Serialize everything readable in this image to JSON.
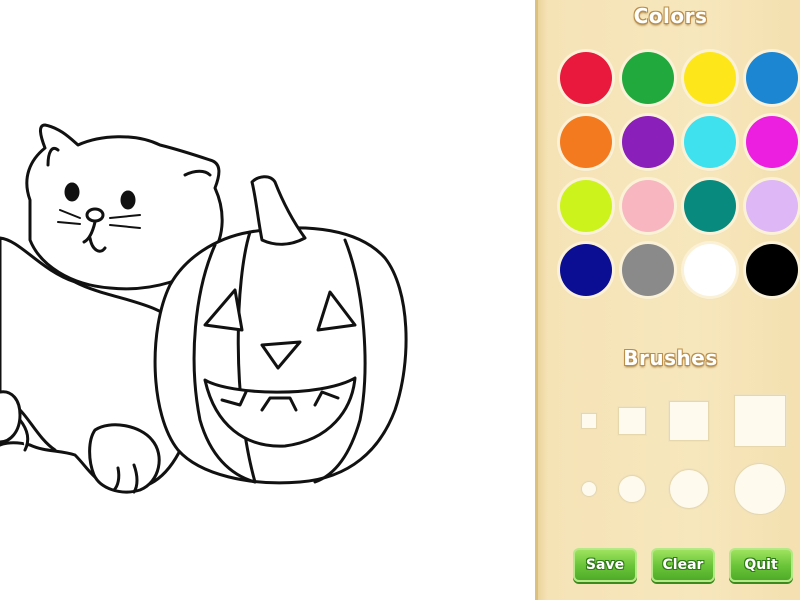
{
  "panel": {
    "colors_title": "Colors",
    "brushes_title": "Brushes",
    "colors": [
      {
        "name": "red",
        "hex": "#e8193c"
      },
      {
        "name": "green",
        "hex": "#21a93d"
      },
      {
        "name": "yellow",
        "hex": "#fde619"
      },
      {
        "name": "blue",
        "hex": "#1c86d3"
      },
      {
        "name": "orange",
        "hex": "#f47a1f"
      },
      {
        "name": "purple",
        "hex": "#8a1fb9"
      },
      {
        "name": "cyan",
        "hex": "#3fe1ee"
      },
      {
        "name": "magenta",
        "hex": "#ec1fe0"
      },
      {
        "name": "lime",
        "hex": "#ccf31c"
      },
      {
        "name": "pink",
        "hex": "#f8b6c1"
      },
      {
        "name": "teal",
        "hex": "#098a7e"
      },
      {
        "name": "lavender",
        "hex": "#ddb7f6"
      },
      {
        "name": "navy",
        "hex": "#0b0d92"
      },
      {
        "name": "gray",
        "hex": "#8a8a8a"
      },
      {
        "name": "white",
        "hex": "#ffffff"
      },
      {
        "name": "black",
        "hex": "#000000"
      }
    ],
    "brushes": [
      {
        "shape": "square",
        "size": "small"
      },
      {
        "shape": "square",
        "size": "medium"
      },
      {
        "shape": "square",
        "size": "large"
      },
      {
        "shape": "square",
        "size": "extra-large"
      },
      {
        "shape": "circle",
        "size": "small"
      },
      {
        "shape": "circle",
        "size": "medium"
      },
      {
        "shape": "circle",
        "size": "large"
      },
      {
        "shape": "circle",
        "size": "extra-large"
      }
    ],
    "buttons": {
      "save_label": "Save",
      "clear_label": "Clear",
      "quit_label": "Quit"
    }
  },
  "canvas": {
    "drawing": "kitten-and-jack-o-lantern-line-art"
  }
}
